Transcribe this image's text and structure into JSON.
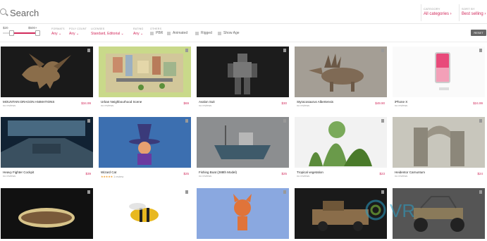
{
  "search": {
    "placeholder": "Search"
  },
  "category": {
    "label": "CATEGORY",
    "value": "All categories ›"
  },
  "sort": {
    "label": "SORT BY",
    "value": "Best selling ›"
  },
  "price": {
    "min": "$20",
    "max": "$500+"
  },
  "filters": {
    "formats": {
      "label": "FORMATS",
      "value": "Any ⌄"
    },
    "poly_count": {
      "label": "POLY COUNT",
      "value": "Any ⌄"
    },
    "licenses": {
      "label": "LICENSES",
      "value": "Standard, Editorial ⌄"
    },
    "rating": {
      "label": "RATING",
      "value": "Any ⌄"
    },
    "other_label": "OTHERS",
    "pbr": "PBR",
    "animated": "Animated",
    "rigged": "Rigged",
    "show_age": "Show Age"
  },
  "reset_label": "RESET",
  "colors": {
    "accent": "#d22a5c",
    "stars": "#f0a030"
  },
  "rows": [
    [
      {
        "title": "MOUNTAIN DRAGON ANIMATIONS",
        "price": "$34.99",
        "reviews": "no reviews",
        "stars": "",
        "thumb": "dragon",
        "bg": "#1a1a1a"
      },
      {
        "title": "Urban Neighbourhood Scene",
        "price": "$69",
        "reviews": "no reviews",
        "stars": "",
        "thumb": "city",
        "bg": "#c9d98a"
      },
      {
        "title": "Avalon Suit",
        "price": "$30",
        "reviews": "no reviews",
        "stars": "",
        "thumb": "robot",
        "bg": "#1c1c1c"
      },
      {
        "title": "Styracosaurus Albertensis",
        "price": "$49.90",
        "reviews": "no reviews",
        "stars": "",
        "thumb": "dino",
        "bg": "#a49e95"
      },
      {
        "title": "iPhone X",
        "price": "$24.99",
        "reviews": "no reviews",
        "stars": "",
        "thumb": "phone",
        "bg": "#fafafa"
      }
    ],
    [
      {
        "title": "Heavy Fighter Cockpit",
        "price": "$39",
        "reviews": "no reviews",
        "stars": "",
        "thumb": "cockpit",
        "bg": "#0e2a3c"
      },
      {
        "title": "Wizard Cat",
        "price": "$25",
        "reviews": "1 review",
        "stars": "★★★★★",
        "thumb": "wizard",
        "bg": "#3c6fb0"
      },
      {
        "title": "Fishing Boat (288th Model)",
        "price": "$25",
        "reviews": "no reviews",
        "stars": "",
        "thumb": "boat",
        "bg": "#8a8c8e"
      },
      {
        "title": "Tropical vegetation",
        "price": "$23",
        "reviews": "no reviews",
        "stars": "",
        "thumb": "plants",
        "bg": "#f2f2f2"
      },
      {
        "title": "Heidentor Carnuntum",
        "price": "$24",
        "reviews": "no reviews",
        "stars": "",
        "thumb": "ruin",
        "bg": "#c8c6bc"
      }
    ],
    [
      {
        "title": "",
        "price": "",
        "reviews": "",
        "stars": "",
        "thumb": "mussel",
        "bg": "#111"
      },
      {
        "title": "",
        "price": "",
        "reviews": "",
        "stars": "",
        "thumb": "wasp",
        "bg": "#ffffff"
      },
      {
        "title": "",
        "price": "",
        "reviews": "",
        "stars": "",
        "thumb": "fox",
        "bg": "#8aa8e0"
      },
      {
        "title": "",
        "price": "",
        "reviews": "",
        "stars": "",
        "thumb": "truck",
        "bg": "#1a1a1a"
      },
      {
        "title": "",
        "price": "",
        "reviews": "",
        "stars": "",
        "thumb": "buggy",
        "bg": "#555"
      }
    ]
  ],
  "watermark": "VR"
}
